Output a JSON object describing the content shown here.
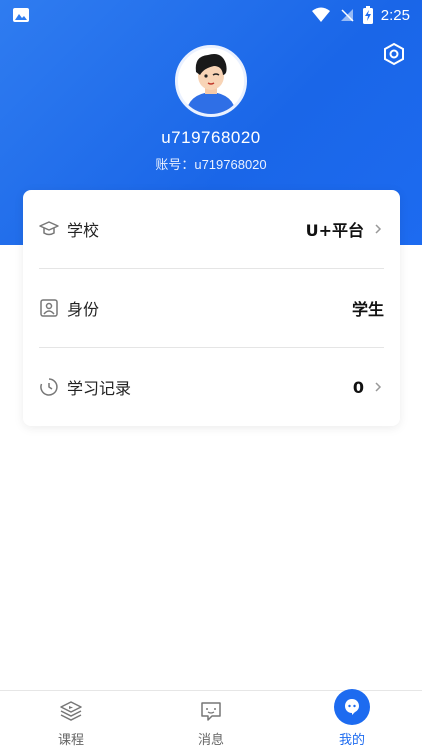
{
  "status_bar": {
    "time": "2:25",
    "icons": [
      "image-icon",
      "wifi-icon",
      "signal-off-icon",
      "battery-charging-icon"
    ]
  },
  "profile": {
    "username": "u719768020",
    "account_line": "账号：u719768020",
    "avatar_icon": "avatar"
  },
  "colors": {
    "accent": "#1d6bf0",
    "header_gradient_start": "#2f7cf0",
    "header_gradient_end": "#1a66e8"
  },
  "info_rows": [
    {
      "icon": "graduation-cap-icon",
      "label": "学校",
      "value": "U+平台",
      "has_chevron": true
    },
    {
      "icon": "id-card-icon",
      "label": "身份",
      "value": "学生",
      "has_chevron": false
    },
    {
      "icon": "history-icon",
      "label": "学习记录",
      "value": "0",
      "has_chevron": true
    }
  ],
  "tabs": [
    {
      "icon": "course-icon",
      "label": "课程",
      "active": false
    },
    {
      "icon": "message-icon",
      "label": "消息",
      "active": false
    },
    {
      "icon": "profile-icon",
      "label": "我的",
      "active": true
    }
  ]
}
